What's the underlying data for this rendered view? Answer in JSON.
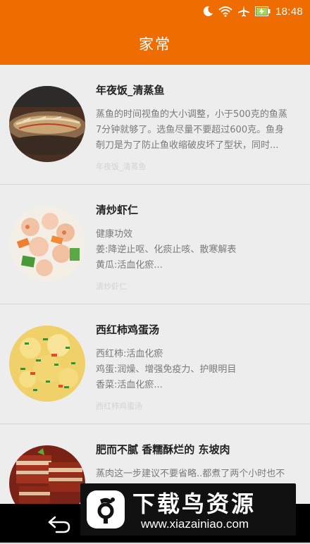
{
  "status_bar": {
    "time": "18:48",
    "icons": [
      "moon-icon",
      "wifi-icon",
      "airplane-icon",
      "battery-charging-icon"
    ]
  },
  "header": {
    "title": "家常"
  },
  "recipes": [
    {
      "title": "年夜饭_清蒸鱼",
      "desc": [
        "蒸鱼的时间视鱼的大小调整，小于500克的鱼蒸",
        "7分钟就够了。选鱼尽量不要超过600克。鱼身",
        "剞刀是为了防止鱼收缩破皮坏了型状，同时..."
      ],
      "tag": "年夜饭_清蒸鱼"
    },
    {
      "title": "清炒虾仁",
      "desc": [
        "健康功效",
        "姜:降逆止呕、化痰止咳、散寒解表",
        "黄瓜:活血化瘀..."
      ],
      "tag": "清炒虾仁"
    },
    {
      "title": "西红柿鸡蛋汤",
      "desc": [
        "西红柿:活血化瘀",
        "鸡蛋:润燥、增强免疫力、护眼明目",
        "香菜:活血化瘀..."
      ],
      "tag": "西红柿鸡蛋汤"
    },
    {
      "title": "肥而不腻 香糯酥烂的 东坡肉",
      "desc": [
        "蒸肉这一步建议不要省略..都煮了两个小时也不"
      ],
      "tag": ""
    }
  ],
  "nav": {
    "back_icon": "back-icon"
  },
  "watermark": {
    "title": "下载鸟资源",
    "url": "www.xiazainiao.com"
  },
  "colors": {
    "accent": "#ef6c00",
    "background": "#ebebeb",
    "title_text": "#222222",
    "desc_text": "#7a7a7a"
  }
}
